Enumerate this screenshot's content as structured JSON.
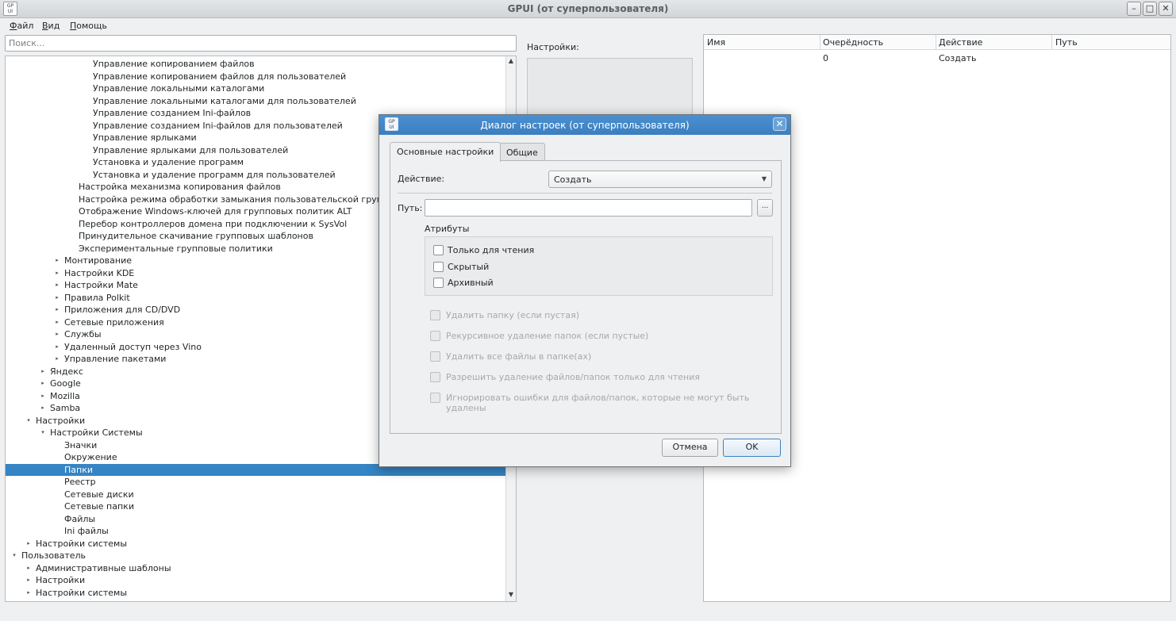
{
  "window": {
    "title": "GPUI (от суперпользователя)",
    "icon_text": "GP UI",
    "controls": [
      "minimize-icon",
      "maximize-icon",
      "close-icon"
    ]
  },
  "menu": [
    "Файл",
    "Вид",
    "Помощь"
  ],
  "search": {
    "placeholder": "Поиск..."
  },
  "settings_panel": {
    "label": "Настройки:"
  },
  "tree": {
    "selected_index": 33,
    "rows": [
      {
        "label": "Управление копированием файлов",
        "level": 5,
        "arrow": ""
      },
      {
        "label": "Управление копированием файлов для пользователей",
        "level": 5,
        "arrow": ""
      },
      {
        "label": "Управление локальными каталогами",
        "level": 5,
        "arrow": ""
      },
      {
        "label": "Управление локальными каталогами для пользователей",
        "level": 5,
        "arrow": ""
      },
      {
        "label": "Управление созданием Ini-файлов",
        "level": 5,
        "arrow": ""
      },
      {
        "label": "Управление созданием Ini-файлов для пользователей",
        "level": 5,
        "arrow": ""
      },
      {
        "label": "Управление ярлыками",
        "level": 5,
        "arrow": ""
      },
      {
        "label": "Управление ярлыками для пользователей",
        "level": 5,
        "arrow": ""
      },
      {
        "label": "Установка и удаление программ",
        "level": 5,
        "arrow": ""
      },
      {
        "label": "Установка и удаление программ для пользователей",
        "level": 5,
        "arrow": ""
      },
      {
        "label": "Настройка механизма копирования файлов",
        "level": 4,
        "arrow": ""
      },
      {
        "label": "Настройка режима обработки замыкания пользовательской групп",
        "level": 4,
        "arrow": ""
      },
      {
        "label": "Отображение Windows-ключей для групповых политик ALT",
        "level": 4,
        "arrow": ""
      },
      {
        "label": "Перебор контроллеров домена при подключении к SysVol",
        "level": 4,
        "arrow": ""
      },
      {
        "label": "Принудительное скачивание групповых шаблонов",
        "level": 4,
        "arrow": ""
      },
      {
        "label": "Экспериментальные групповые политики",
        "level": 4,
        "arrow": ""
      },
      {
        "label": "Монтирование",
        "level": 3,
        "arrow": "▸"
      },
      {
        "label": "Настройки KDE",
        "level": 3,
        "arrow": "▸"
      },
      {
        "label": "Настройки Mate",
        "level": 3,
        "arrow": "▸"
      },
      {
        "label": "Правила Polkit",
        "level": 3,
        "arrow": "▸"
      },
      {
        "label": "Приложения для CD/DVD",
        "level": 3,
        "arrow": "▸"
      },
      {
        "label": "Сетевые приложения",
        "level": 3,
        "arrow": "▸"
      },
      {
        "label": "Службы",
        "level": 3,
        "arrow": "▸"
      },
      {
        "label": "Удаленный доступ через Vino",
        "level": 3,
        "arrow": "▸"
      },
      {
        "label": "Управление пакетами",
        "level": 3,
        "arrow": "▸"
      },
      {
        "label": "Яндекс",
        "level": 2,
        "arrow": "▸"
      },
      {
        "label": "Google",
        "level": 2,
        "arrow": "▸"
      },
      {
        "label": "Mozilla",
        "level": 2,
        "arrow": "▸"
      },
      {
        "label": "Samba",
        "level": 2,
        "arrow": "▸"
      },
      {
        "label": "Настройки",
        "level": 1,
        "arrow": "▾"
      },
      {
        "label": "Настройки Системы",
        "level": 2,
        "arrow": "▾"
      },
      {
        "label": "Значки",
        "level": 3,
        "arrow": ""
      },
      {
        "label": "Окружение",
        "level": 3,
        "arrow": ""
      },
      {
        "label": "Папки",
        "level": 3,
        "arrow": ""
      },
      {
        "label": "Реестр",
        "level": 3,
        "arrow": ""
      },
      {
        "label": "Сетевые диски",
        "level": 3,
        "arrow": ""
      },
      {
        "label": "Сетевые папки",
        "level": 3,
        "arrow": ""
      },
      {
        "label": "Файлы",
        "level": 3,
        "arrow": ""
      },
      {
        "label": "Ini файлы",
        "level": 3,
        "arrow": ""
      },
      {
        "label": "Настройки системы",
        "level": 1,
        "arrow": "▸"
      },
      {
        "label": "Пользователь",
        "level": 0,
        "arrow": "▾"
      },
      {
        "label": "Административные шаблоны",
        "level": 1,
        "arrow": "▸"
      },
      {
        "label": "Настройки",
        "level": 1,
        "arrow": "▸"
      },
      {
        "label": "Настройки системы",
        "level": 1,
        "arrow": "▸"
      }
    ]
  },
  "table": {
    "columns": [
      "Имя",
      "Очерёдность",
      "Действие",
      "Путь"
    ],
    "rows": [
      {
        "name": "",
        "order": "0",
        "action": "Создать",
        "path": ""
      }
    ]
  },
  "dialog": {
    "title": "Диалог настроек (от суперпользователя)",
    "icon_text": "GP UI",
    "tabs": [
      "Основные настройки",
      "Общие"
    ],
    "action_label": "Действие:",
    "action_value": "Создать",
    "path_label": "Путь:",
    "path_value": "",
    "browse_label": "...",
    "attributes_label": "Атрибуты",
    "attributes": [
      {
        "label": "Только для чтения",
        "checked": false
      },
      {
        "label": "Скрытый",
        "checked": false
      },
      {
        "label": "Архивный",
        "checked": false
      }
    ],
    "options": [
      {
        "label": "Удалить папку (если пустая)",
        "enabled": false
      },
      {
        "label": "Рекурсивное удаление папок (если пустые)",
        "enabled": false
      },
      {
        "label": "Удалить все файлы в папке(ах)",
        "enabled": false
      },
      {
        "label": "Разрешить удаление файлов/папок только для чтения",
        "enabled": false
      },
      {
        "label": "Игнорировать ошибки для файлов/папок, которые не могут быть удалены",
        "enabled": false
      }
    ],
    "cancel_label": "Отмена",
    "ok_label": "OK"
  },
  "colors": {
    "selection": "#3584c4",
    "dialog_titlebar": "#4b8fd0"
  }
}
